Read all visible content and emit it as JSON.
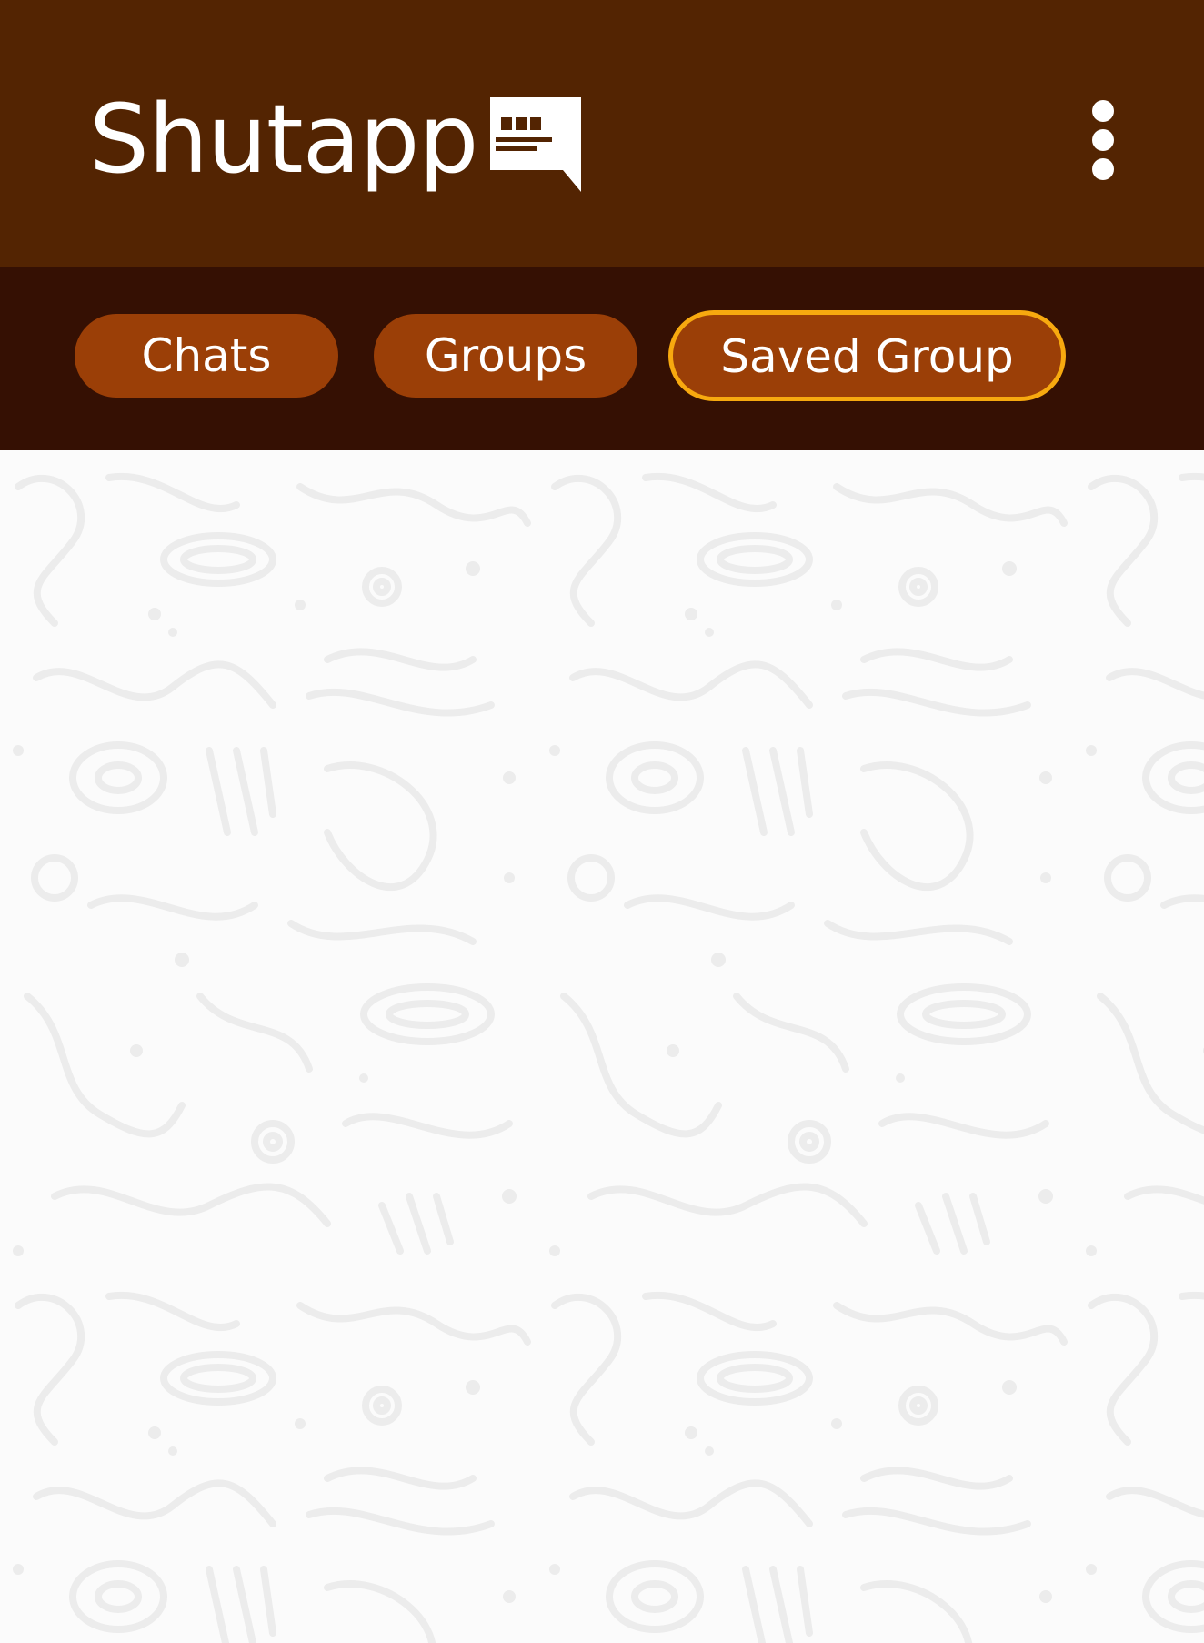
{
  "appbar": {
    "title": "Shutapp",
    "logo_icon": "chat-bubble-icon",
    "menu_icon": "more-vertical-icon"
  },
  "tabs": [
    {
      "label": "Chats",
      "selected": false
    },
    {
      "label": "Groups",
      "selected": false
    },
    {
      "label": "Saved Group",
      "selected": true
    }
  ],
  "colors": {
    "appbar_bg": "#532402",
    "tabbar_bg": "#351003",
    "tab_bg": "#9b3f07",
    "selected_outline": "#f7a90f",
    "content_bg": "#fbfbfb",
    "pattern_stroke": "#ececec"
  }
}
